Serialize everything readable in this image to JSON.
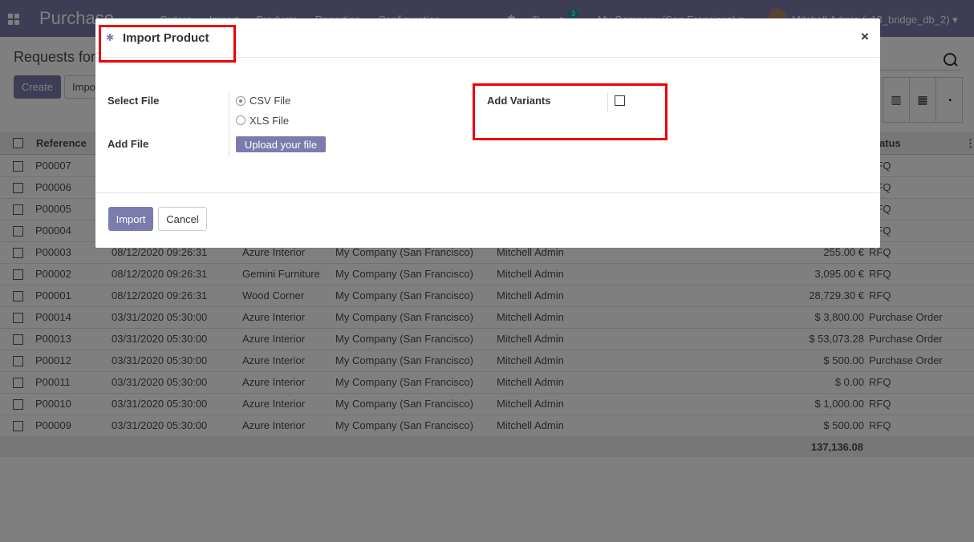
{
  "navbar": {
    "brand": "Purchase",
    "menu": [
      "Orders",
      "Import",
      "Products",
      "Reporting",
      "Configuration"
    ],
    "chat_count": "3",
    "company": "My Company (San Francisco) ▾",
    "user": "Mitchell Admin (v13_bridge_db_2) ▾"
  },
  "control_panel": {
    "breadcrumb": "Requests for Quotation",
    "create_label": "Create",
    "import_label": "Import"
  },
  "table": {
    "headers": {
      "reference": "Reference",
      "status": "Status"
    },
    "rows": [
      {
        "ref": "P00007",
        "date": "",
        "vendor": "",
        "company": "",
        "agent": "",
        "total": "",
        "status": "RFQ"
      },
      {
        "ref": "P00006",
        "date": "",
        "vendor": "",
        "company": "",
        "agent": "",
        "total": "",
        "status": "RFQ"
      },
      {
        "ref": "P00005",
        "date": "",
        "vendor": "",
        "company": "",
        "agent": "",
        "total": "",
        "status": "RFQ"
      },
      {
        "ref": "P00004",
        "date": "",
        "vendor": "",
        "company": "",
        "agent": "",
        "total": "",
        "status": "RFQ"
      },
      {
        "ref": "P00003",
        "date": "08/12/2020 09:26:31",
        "vendor": "Azure Interior",
        "company": "My Company (San Francisco)",
        "agent": "Mitchell Admin",
        "total": "255.00 €",
        "status": "RFQ"
      },
      {
        "ref": "P00002",
        "date": "08/12/2020 09:26:31",
        "vendor": "Gemini Furniture",
        "company": "My Company (San Francisco)",
        "agent": "Mitchell Admin",
        "total": "3,095.00 €",
        "status": "RFQ"
      },
      {
        "ref": "P00001",
        "date": "08/12/2020 09:26:31",
        "vendor": "Wood Corner",
        "company": "My Company (San Francisco)",
        "agent": "Mitchell Admin",
        "total": "28,729.30 €",
        "status": "RFQ"
      },
      {
        "ref": "P00014",
        "date": "03/31/2020 05:30:00",
        "vendor": "Azure Interior",
        "company": "My Company (San Francisco)",
        "agent": "Mitchell Admin",
        "total": "$ 3,800.00",
        "status": "Purchase Order"
      },
      {
        "ref": "P00013",
        "date": "03/31/2020 05:30:00",
        "vendor": "Azure Interior",
        "company": "My Company (San Francisco)",
        "agent": "Mitchell Admin",
        "total": "$ 53,073.28",
        "status": "Purchase Order"
      },
      {
        "ref": "P00012",
        "date": "03/31/2020 05:30:00",
        "vendor": "Azure Interior",
        "company": "My Company (San Francisco)",
        "agent": "Mitchell Admin",
        "total": "$ 500.00",
        "status": "Purchase Order"
      },
      {
        "ref": "P00011",
        "date": "03/31/2020 05:30:00",
        "vendor": "Azure Interior",
        "company": "My Company (San Francisco)",
        "agent": "Mitchell Admin",
        "total": "$ 0.00",
        "status": "RFQ"
      },
      {
        "ref": "P00010",
        "date": "03/31/2020 05:30:00",
        "vendor": "Azure Interior",
        "company": "My Company (San Francisco)",
        "agent": "Mitchell Admin",
        "total": "$ 1,000.00",
        "status": "RFQ"
      },
      {
        "ref": "P00009",
        "date": "03/31/2020 05:30:00",
        "vendor": "Azure Interior",
        "company": "My Company (San Francisco)",
        "agent": "Mitchell Admin",
        "total": "$ 500.00",
        "status": "RFQ"
      }
    ],
    "grand_total": "137,136.08"
  },
  "dialog": {
    "title": "Import Product",
    "close_glyph": "×",
    "select_file_label": "Select File",
    "csv_option": "CSV File",
    "xls_option": "XLS File",
    "selected_option": "CSV File",
    "add_file_label": "Add File",
    "upload_label": "Upload your file",
    "add_variants_label": "Add Variants",
    "add_variants_checked": false,
    "import_label": "Import",
    "cancel_label": "Cancel"
  },
  "colors": {
    "brand": "#7c7bad",
    "highlight": "#ee0000"
  }
}
